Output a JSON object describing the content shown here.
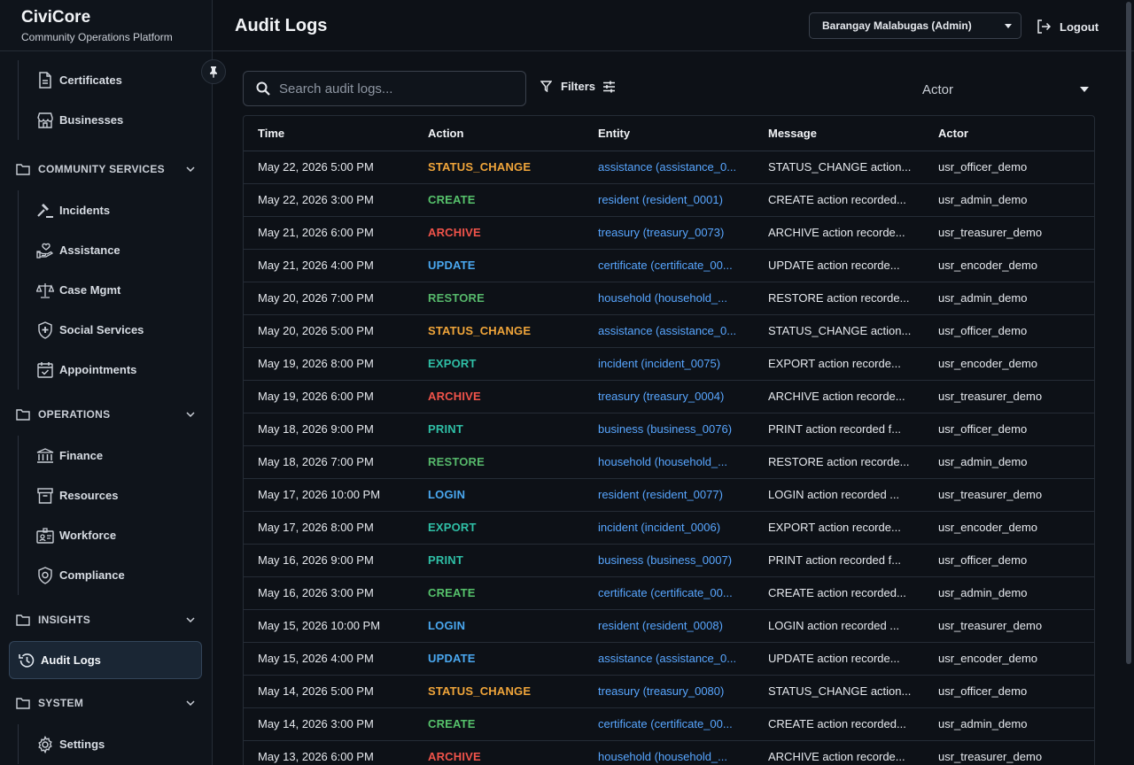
{
  "brand": {
    "name": "CiviCore",
    "subtitle": "Community Operations Platform"
  },
  "sidebar": {
    "top_items": [
      {
        "label": "Certificates",
        "icon": "document-icon"
      },
      {
        "label": "Businesses",
        "icon": "storefront-icon"
      }
    ],
    "sections": [
      {
        "title": "COMMUNITY SERVICES",
        "items": [
          {
            "label": "Incidents",
            "icon": "gavel-icon"
          },
          {
            "label": "Assistance",
            "icon": "hand-heart-icon"
          },
          {
            "label": "Case Mgmt",
            "icon": "scale-icon"
          },
          {
            "label": "Social Services",
            "icon": "shield-plus-icon"
          },
          {
            "label": "Appointments",
            "icon": "calendar-check-icon"
          }
        ]
      },
      {
        "title": "OPERATIONS",
        "items": [
          {
            "label": "Finance",
            "icon": "bank-icon"
          },
          {
            "label": "Resources",
            "icon": "archive-box-icon"
          },
          {
            "label": "Workforce",
            "icon": "badge-icon"
          },
          {
            "label": "Compliance",
            "icon": "shield-check-icon"
          }
        ]
      },
      {
        "title": "INSIGHTS",
        "items": [
          {
            "label": "Audit Logs",
            "icon": "history-icon",
            "active": true
          }
        ]
      },
      {
        "title": "SYSTEM",
        "items": [
          {
            "label": "Settings",
            "icon": "gear-icon"
          }
        ]
      }
    ]
  },
  "header": {
    "title": "Audit Logs",
    "barangay_select": "Barangay Malabugas (Admin)",
    "logout_label": "Logout"
  },
  "toolbar": {
    "search_placeholder": "Search audit logs...",
    "filters_label": "Filters",
    "actor_select": "Actor"
  },
  "table": {
    "columns": [
      "Time",
      "Action",
      "Entity",
      "Message",
      "Actor"
    ],
    "rows": [
      [
        "May 22, 2026 5:00 PM",
        "STATUS_CHANGE",
        "assistance (assistance_0...",
        "STATUS_CHANGE action...",
        "usr_officer_demo"
      ],
      [
        "May 22, 2026 3:00 PM",
        "CREATE",
        "resident (resident_0001)",
        "CREATE action recorded...",
        "usr_admin_demo"
      ],
      [
        "May 21, 2026 6:00 PM",
        "ARCHIVE",
        "treasury (treasury_0073)",
        "ARCHIVE action recorde...",
        "usr_treasurer_demo"
      ],
      [
        "May 21, 2026 4:00 PM",
        "UPDATE",
        "certificate (certificate_00...",
        "UPDATE action recorde...",
        "usr_encoder_demo"
      ],
      [
        "May 20, 2026 7:00 PM",
        "RESTORE",
        "household (household_...",
        "RESTORE action recorde...",
        "usr_admin_demo"
      ],
      [
        "May 20, 2026 5:00 PM",
        "STATUS_CHANGE",
        "assistance (assistance_0...",
        "STATUS_CHANGE action...",
        "usr_officer_demo"
      ],
      [
        "May 19, 2026 8:00 PM",
        "EXPORT",
        "incident (incident_0075)",
        "EXPORT action recorde...",
        "usr_encoder_demo"
      ],
      [
        "May 19, 2026 6:00 PM",
        "ARCHIVE",
        "treasury (treasury_0004)",
        "ARCHIVE action recorde...",
        "usr_treasurer_demo"
      ],
      [
        "May 18, 2026 9:00 PM",
        "PRINT",
        "business (business_0076)",
        "PRINT action recorded f...",
        "usr_officer_demo"
      ],
      [
        "May 18, 2026 7:00 PM",
        "RESTORE",
        "household (household_...",
        "RESTORE action recorde...",
        "usr_admin_demo"
      ],
      [
        "May 17, 2026 10:00 PM",
        "LOGIN",
        "resident (resident_0077)",
        "LOGIN action recorded ...",
        "usr_treasurer_demo"
      ],
      [
        "May 17, 2026 8:00 PM",
        "EXPORT",
        "incident (incident_0006)",
        "EXPORT action recorde...",
        "usr_encoder_demo"
      ],
      [
        "May 16, 2026 9:00 PM",
        "PRINT",
        "business (business_0007)",
        "PRINT action recorded f...",
        "usr_officer_demo"
      ],
      [
        "May 16, 2026 3:00 PM",
        "CREATE",
        "certificate (certificate_00...",
        "CREATE action recorded...",
        "usr_admin_demo"
      ],
      [
        "May 15, 2026 10:00 PM",
        "LOGIN",
        "resident (resident_0008)",
        "LOGIN action recorded ...",
        "usr_treasurer_demo"
      ],
      [
        "May 15, 2026 4:00 PM",
        "UPDATE",
        "assistance (assistance_0...",
        "UPDATE action recorde...",
        "usr_encoder_demo"
      ],
      [
        "May 14, 2026 5:00 PM",
        "STATUS_CHANGE",
        "treasury (treasury_0080)",
        "STATUS_CHANGE action...",
        "usr_officer_demo"
      ],
      [
        "May 14, 2026 3:00 PM",
        "CREATE",
        "certificate (certificate_00...",
        "CREATE action recorded...",
        "usr_admin_demo"
      ],
      [
        "May 13, 2026 6:00 PM",
        "ARCHIVE",
        "household (household_...",
        "ARCHIVE action recorde...",
        "usr_treasurer_demo"
      ]
    ]
  },
  "colors": {
    "background": "#0d1117",
    "entity_link": "#58a6ff",
    "status_change": "#f0a53a",
    "create": "#56c26b",
    "archive": "#f0534a",
    "update": "#4aa8f0",
    "export": "#2fbfa6"
  }
}
